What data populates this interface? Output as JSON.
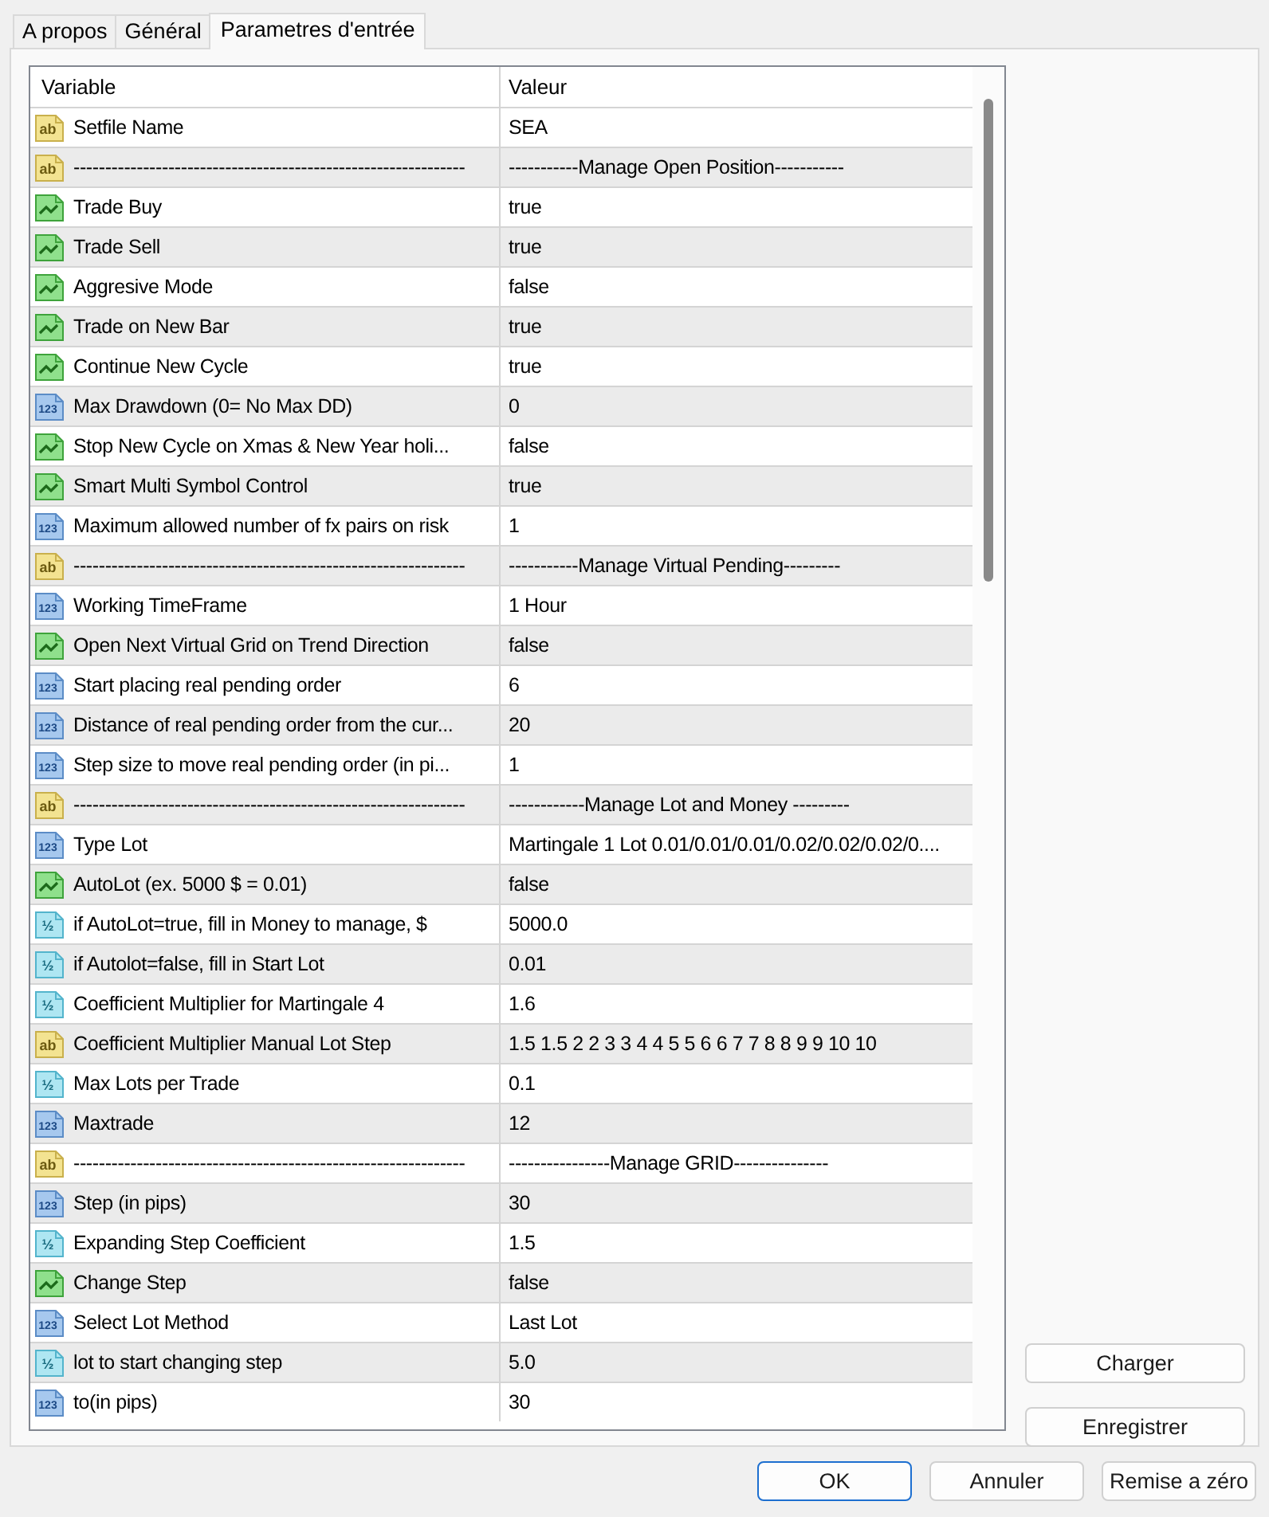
{
  "tabs": [
    {
      "label": "A propos",
      "selected": false
    },
    {
      "label": "Général",
      "selected": false
    },
    {
      "label": "Parametres d'entrée",
      "selected": true
    }
  ],
  "table": {
    "columns": [
      "Variable",
      "Valeur"
    ],
    "rows": [
      {
        "kind": "string",
        "icon_text": "ab",
        "variable": "Setfile Name",
        "value": "SEA"
      },
      {
        "kind": "string",
        "icon_text": "ab",
        "variable": "--------------------------------------------------------------",
        "value": "-----------Manage Open Position-----------"
      },
      {
        "kind": "bool",
        "variable": "Trade Buy",
        "value": "true"
      },
      {
        "kind": "bool",
        "variable": "Trade Sell",
        "value": "true"
      },
      {
        "kind": "bool",
        "variable": "Aggresive Mode",
        "value": "false"
      },
      {
        "kind": "bool",
        "variable": "Trade on New Bar",
        "value": "true"
      },
      {
        "kind": "bool",
        "variable": "Continue New Cycle",
        "value": "true"
      },
      {
        "kind": "int",
        "icon_text": "123",
        "variable": "Max Drawdown (0= No Max DD)",
        "value": "0"
      },
      {
        "kind": "bool",
        "variable": "Stop New Cycle on Xmas & New Year holi...",
        "value": "false"
      },
      {
        "kind": "bool",
        "variable": "Smart Multi Symbol Control",
        "value": "true"
      },
      {
        "kind": "int",
        "icon_text": "123",
        "variable": "Maximum allowed number of fx pairs on risk",
        "value": "1"
      },
      {
        "kind": "string",
        "icon_text": "ab",
        "variable": "--------------------------------------------------------------",
        "value": "-----------Manage Virtual Pending---------"
      },
      {
        "kind": "int",
        "icon_text": "123",
        "variable": "Working TimeFrame",
        "value": "1 Hour"
      },
      {
        "kind": "bool",
        "variable": "Open Next Virtual Grid on Trend Direction",
        "value": "false"
      },
      {
        "kind": "int",
        "icon_text": "123",
        "variable": "Start placing real pending order",
        "value": "6"
      },
      {
        "kind": "int",
        "icon_text": "123",
        "variable": "Distance of real pending order from the cur...",
        "value": "20"
      },
      {
        "kind": "int",
        "icon_text": "123",
        "variable": "Step size to move real pending order (in pi...",
        "value": "1"
      },
      {
        "kind": "string",
        "icon_text": "ab",
        "variable": "--------------------------------------------------------------",
        "value": "------------Manage Lot and Money ---------"
      },
      {
        "kind": "int",
        "icon_text": "123",
        "variable": "Type Lot",
        "value": "Martingale 1 Lot 0.01/0.01/0.01/0.02/0.02/0.02/0...."
      },
      {
        "kind": "bool",
        "variable": "AutoLot (ex. 5000 $ = 0.01)",
        "value": "false"
      },
      {
        "kind": "double",
        "icon_text": "½",
        "variable": "if AutoLot=true, fill in Money to manage, $",
        "value": "5000.0"
      },
      {
        "kind": "double",
        "icon_text": "½",
        "variable": "if Autolot=false, fill in Start Lot",
        "value": "0.01"
      },
      {
        "kind": "double",
        "icon_text": "½",
        "variable": "Coefficient Multiplier for Martingale 4",
        "value": "1.6"
      },
      {
        "kind": "string",
        "icon_text": "ab",
        "variable": "Coefficient Multiplier Manual Lot Step",
        "value": "1.5 1.5 2 2 3 3 4 4 5 5 6 6 7 7 8 8 9 9 10 10"
      },
      {
        "kind": "double",
        "icon_text": "½",
        "variable": "Max Lots per Trade",
        "value": "0.1"
      },
      {
        "kind": "int",
        "icon_text": "123",
        "variable": "Maxtrade",
        "value": "12"
      },
      {
        "kind": "string",
        "icon_text": "ab",
        "variable": "--------------------------------------------------------------",
        "value": "----------------Manage GRID---------------"
      },
      {
        "kind": "int",
        "icon_text": "123",
        "variable": "Step (in pips)",
        "value": "30"
      },
      {
        "kind": "double",
        "icon_text": "½",
        "variable": "Expanding Step Coefficient",
        "value": "1.5"
      },
      {
        "kind": "bool",
        "variable": "Change Step",
        "value": "false"
      },
      {
        "kind": "int",
        "icon_text": "123",
        "variable": "Select Lot Method",
        "value": "Last Lot"
      },
      {
        "kind": "double",
        "icon_text": "½",
        "variable": "lot to start changing step",
        "value": "5.0"
      },
      {
        "kind": "int",
        "icon_text": "123",
        "variable": "to(in pips)",
        "value": "30"
      }
    ]
  },
  "side_buttons": [
    "Charger",
    "Enregistrer"
  ],
  "buttons": [
    {
      "label": "OK",
      "default": true
    },
    {
      "label": "Annuler",
      "default": false
    },
    {
      "label": "Remise a zéro",
      "default": false
    }
  ]
}
